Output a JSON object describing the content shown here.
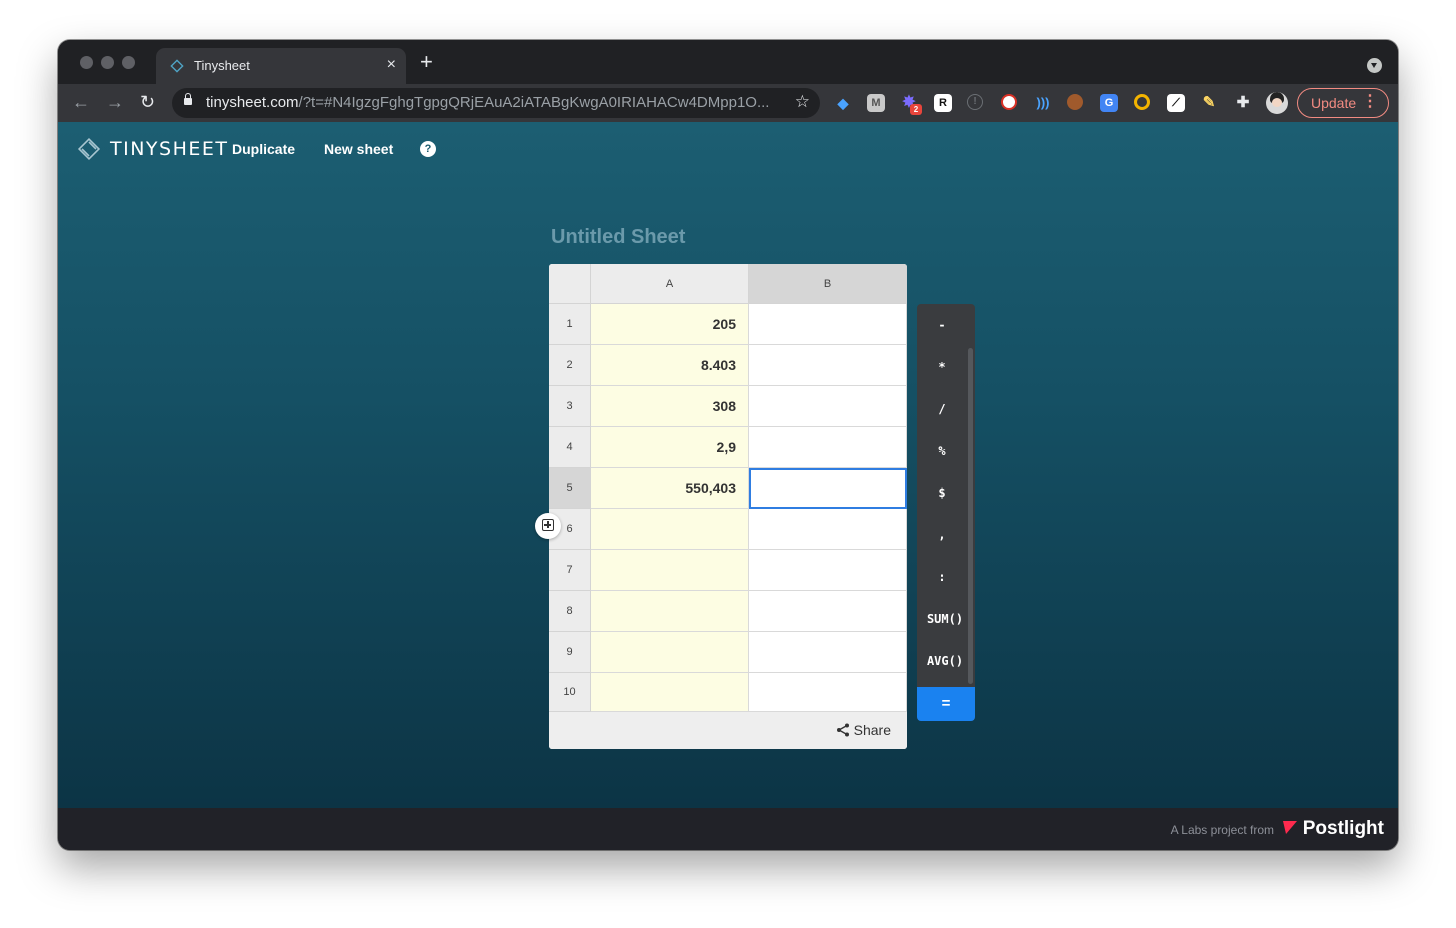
{
  "browser": {
    "tab": {
      "title": "Tinysheet",
      "close": "×"
    },
    "new_tab": "+",
    "url_host": "tinysheet.com",
    "url_rest": "/?t=#N4IgzgFghgTgpgQRjEAuA2iATABgKwgA0IRIAHACw4DMpp1O...",
    "update_label": "Update",
    "update_menu": "⋮",
    "extension_badge": "2",
    "colors": {
      "frame": "#202124",
      "toolbar": "#35363a",
      "update": "#f28b82"
    }
  },
  "app": {
    "brand": "TINYSHEET",
    "nav": {
      "duplicate": "Duplicate",
      "new_sheet": "New sheet",
      "help": "?"
    },
    "sheet_title": "Untitled Sheet",
    "columns": [
      "A",
      "B"
    ],
    "rows": [
      {
        "num": "1",
        "a": "205",
        "b": ""
      },
      {
        "num": "2",
        "a": "8.403",
        "b": ""
      },
      {
        "num": "3",
        "a": "308",
        "b": ""
      },
      {
        "num": "4",
        "a": "2,9",
        "b": ""
      },
      {
        "num": "5",
        "a": "550,403",
        "b": ""
      },
      {
        "num": "6",
        "a": "",
        "b": ""
      },
      {
        "num": "7",
        "a": "",
        "b": ""
      },
      {
        "num": "8",
        "a": "",
        "b": ""
      },
      {
        "num": "9",
        "a": "",
        "b": ""
      },
      {
        "num": "10",
        "a": "",
        "b": ""
      }
    ],
    "share_label": "Share",
    "keypad": [
      "-",
      "*",
      "/",
      "%",
      "$",
      ",",
      ":",
      "SUM()",
      "AVG()"
    ],
    "equals": "=",
    "colors": {
      "accent": "#1a82f0",
      "column_a": "#fdfde3",
      "background": "#155064"
    }
  },
  "footer": {
    "labs_text": "A Labs project from",
    "company": "Postlight"
  }
}
